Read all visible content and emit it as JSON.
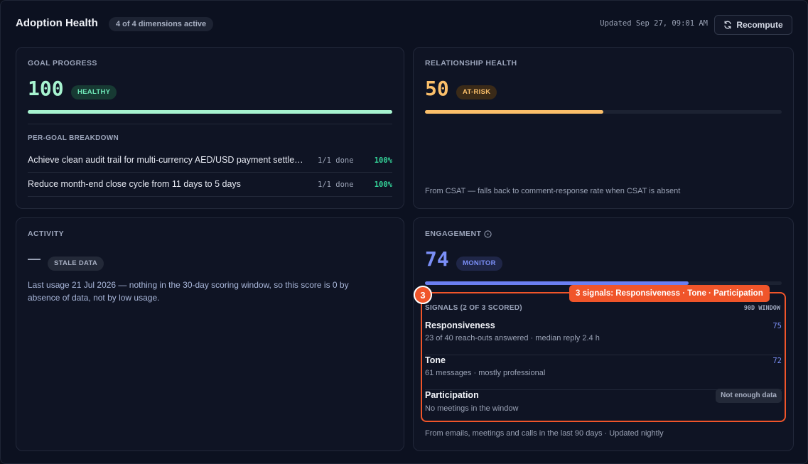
{
  "header": {
    "title": "Adoption Health",
    "dimensions_badge": "4 of 4 dimensions active",
    "updated": "Updated Sep 27, 09:01 AM",
    "recompute_label": "Recompute"
  },
  "colors": {
    "healthy": "#a7f3d0",
    "at_risk": "#fbbf6a",
    "monitor": "#7b8ff7",
    "highlight": "#f0552a"
  },
  "goal_progress": {
    "label": "GOAL PROGRESS",
    "score": "100",
    "status": "HEALTHY",
    "progress": 1.0,
    "breakdown_label": "PER-GOAL BREAKDOWN",
    "goals": [
      {
        "text": "Achieve clean audit trail for multi-currency AED/USD payment settle…",
        "done": "1/1 done",
        "pct": "100%"
      },
      {
        "text": "Reduce month-end close cycle from 11 days to 5 days",
        "done": "1/1 done",
        "pct": "100%"
      }
    ]
  },
  "relationship_health": {
    "label": "RELATIONSHIP HEALTH",
    "score": "50",
    "status": "AT-RISK",
    "progress": 0.5,
    "footnote": "From CSAT — falls back to comment-response rate when CSAT is absent"
  },
  "activity": {
    "label": "ACTIVITY",
    "status": "STALE DATA",
    "text": "Last usage 21 Jul 2026 — nothing in the 30-day scoring window, so this score is 0 by absence of data, not by low usage."
  },
  "engagement": {
    "label": "ENGAGEMENT",
    "score": "74",
    "status": "MONITOR",
    "progress": 0.74,
    "signals_label": "SIGNALS (2 OF 3 SCORED)",
    "window_label": "90D WINDOW",
    "signals": [
      {
        "name": "Responsiveness",
        "detail": "23 of 40 reach-outs answered · median reply 2.4 h",
        "score": "75"
      },
      {
        "name": "Tone",
        "detail": "61 messages · mostly professional",
        "score": "72"
      },
      {
        "name": "Participation",
        "detail": "No meetings in the window",
        "badge": "Not enough data"
      }
    ],
    "footnote": "From emails, meetings and calls in the last 90 days · Updated nightly"
  },
  "annotation": {
    "number": "3",
    "tag": "3 signals: Responsiveness · Tone · Participation"
  }
}
